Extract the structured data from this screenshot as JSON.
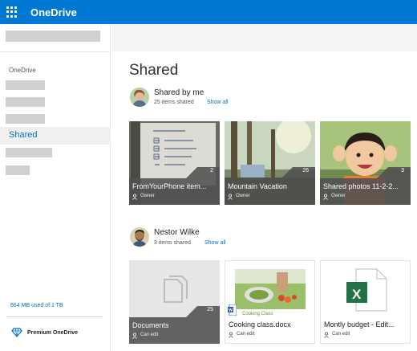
{
  "header": {
    "app_name": "OneDrive",
    "accent": "#0078d4"
  },
  "sidebar": {
    "nav_heading": "OneDrive",
    "active_item": "Shared",
    "storage_text": "664 MB used of 1 TB",
    "premium_label": "Premium OneDrive"
  },
  "main": {
    "page_title": "Shared",
    "groups": [
      {
        "owner": "Shared by me",
        "count_text": "25 items shared",
        "show_all": "Show all",
        "tiles": [
          {
            "title": "FromYourPhone item...",
            "count": "2",
            "sub": "Owner"
          },
          {
            "title": "Mountain Vacation",
            "count": "26",
            "sub": "Owner"
          },
          {
            "title": "Shared photos 11-2-2...",
            "count": "3",
            "sub": "Owner"
          }
        ]
      },
      {
        "owner": "Nestor Wilke",
        "count_text": "3 items shared",
        "show_all": "Show all",
        "tiles": [
          {
            "title": "Documents",
            "count": "25",
            "sub": "Can edit"
          },
          {
            "title": "Cooking class.docx",
            "sub": "Can edit",
            "image_text": "Cooking Class"
          },
          {
            "title": "Montly budget - Edit...",
            "sub": "Can edit",
            "file_badge": "X"
          }
        ]
      }
    ]
  }
}
